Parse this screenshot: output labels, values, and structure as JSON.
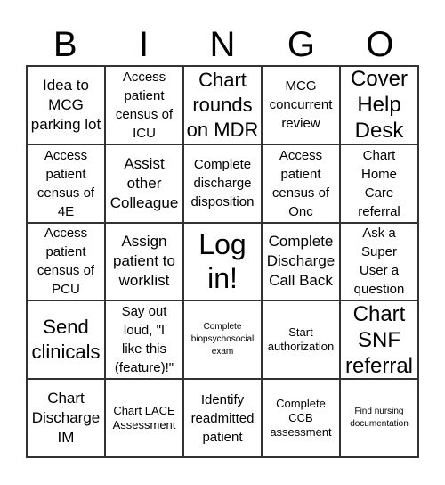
{
  "header": {
    "letters": [
      "B",
      "I",
      "N",
      "G",
      "O"
    ]
  },
  "board": {
    "cells": [
      {
        "text": "Idea to\nMCG\nparking lot",
        "size": "fs-ml"
      },
      {
        "text": "Access\npatient\ncensus of\nICU",
        "size": "fs-m"
      },
      {
        "text": "Chart\nrounds\non MDR",
        "size": "fs-xl"
      },
      {
        "text": "MCG\nconcurrent\nreview",
        "size": "fs-m"
      },
      {
        "text": "Cover\nHelp\nDesk",
        "size": "fs-xxl"
      },
      {
        "text": "Access\npatient\ncensus of\n4E",
        "size": "fs-m"
      },
      {
        "text": "Assist\nother\nColleague",
        "size": "fs-ml"
      },
      {
        "text": "Complete\ndischarge\ndisposition",
        "size": "fs-m"
      },
      {
        "text": "Access\npatient\ncensus of\nOnc",
        "size": "fs-m"
      },
      {
        "text": "Chart\nHome\nCare\nreferral",
        "size": "fs-m"
      },
      {
        "text": "Access\npatient\ncensus of\nPCU",
        "size": "fs-m"
      },
      {
        "text": "Assign\npatient to\nworklist",
        "size": "fs-ml"
      },
      {
        "text": "Log\nin!",
        "size": "fs-free"
      },
      {
        "text": "Complete\nDischarge\nCall Back",
        "size": "fs-ml"
      },
      {
        "text": "Ask a\nSuper\nUser a\nquestion",
        "size": "fs-m"
      },
      {
        "text": "Send\nclinicals",
        "size": "fs-xl"
      },
      {
        "text": "Say out\nloud, \"I\nlike this\n(feature)!\"",
        "size": "fs-m"
      },
      {
        "text": "Complete\nbiopsychosocial\nexam",
        "size": "fs-xs"
      },
      {
        "text": "Start\nauthorization",
        "size": "fs-s"
      },
      {
        "text": "Chart\nSNF\nreferral",
        "size": "fs-xxl"
      },
      {
        "text": "Chart\nDischarge\nIM",
        "size": "fs-ml"
      },
      {
        "text": "Chart LACE\nAssessment",
        "size": "fs-s"
      },
      {
        "text": "Identify\nreadmitted\npatient",
        "size": "fs-m"
      },
      {
        "text": "Complete\nCCB\nassessment",
        "size": "fs-s"
      },
      {
        "text": "Find nursing\ndocumentation",
        "size": "fs-xs"
      }
    ]
  }
}
